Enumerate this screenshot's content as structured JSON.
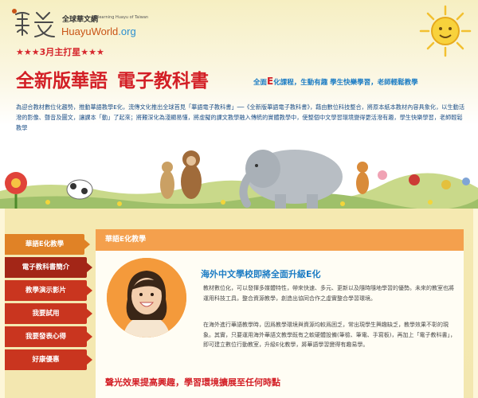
{
  "brand": {
    "cn_name": "全球華文網",
    "en_small": "E-learning Huayu of Taiwan",
    "en_name_a": "HuayuWorld",
    "en_name_b": ".org"
  },
  "promo": {
    "star_line": "★★★3月主打星★★★",
    "headline_a": "全新版華語",
    "headline_b": "電子教科書",
    "tagline_pre": "全面",
    "tagline_e": "E",
    "tagline_post": "化課程，生動有趣  學生快樂學習，老師輕鬆教學"
  },
  "intro_text": "為迎合教材數位化趨勢，推動華語教學E化，流傳文化推出全球首見「華語電子教科書」──《全新版華語電子教科書》，藉由數位科技整合，將原本紙本教材內容具象化，以生動活潑的影像、聲音及圖文，讓課本「動」了起來；將艱深化為淺顯易懂，將虛擬的課文教學融入傳統的實體教學中，使整個中文學習環境變得更活潑有趣，學生快樂學習，老師輕鬆教學",
  "nav": {
    "items": [
      {
        "label": "華語E化教學"
      },
      {
        "label": "電子教科書簡介"
      },
      {
        "label": "教學演示影片"
      },
      {
        "label": "我要試用"
      },
      {
        "label": "我要發表心得"
      },
      {
        "label": "好康優惠"
      }
    ]
  },
  "content": {
    "section_title": "華語E化教學",
    "article_title": "海外中文學校即將全面升級E化",
    "paragraph1": "教材數位化，可以發揮多媒體特性，帶來快速、多元、更新以及隨時隨地學習的優勢。未來的教室也將運用科技工具，整合資源教學，創造出協同合作之虛實整合學習環境。",
    "paragraph2": "在海外進行華語教學時，因爲教學環境與資源均較爲困乏，常出現學生興趣缺乏，教學效果不彰的現象。其實，只要運用海外華語文教學既有之軟硬體設備(筆檢、筆電、手寫板)，再加上「電子教科書」，即可建立數位行動教室，升級E化教學，將華語學習變得有趣易學。",
    "subheading": "聲光效果提高興趣，學習環境擴展至任何時點"
  },
  "colors": {
    "red": "#d31f26",
    "blue": "#1b7cc4",
    "orange": "#f4a04d",
    "nav_red": "#c9351f",
    "nav_active": "#e08226",
    "panel_bg": "#f5e9b1"
  },
  "icons": {
    "logo": "huayu-logo-mark",
    "sun": "sun-icon"
  }
}
